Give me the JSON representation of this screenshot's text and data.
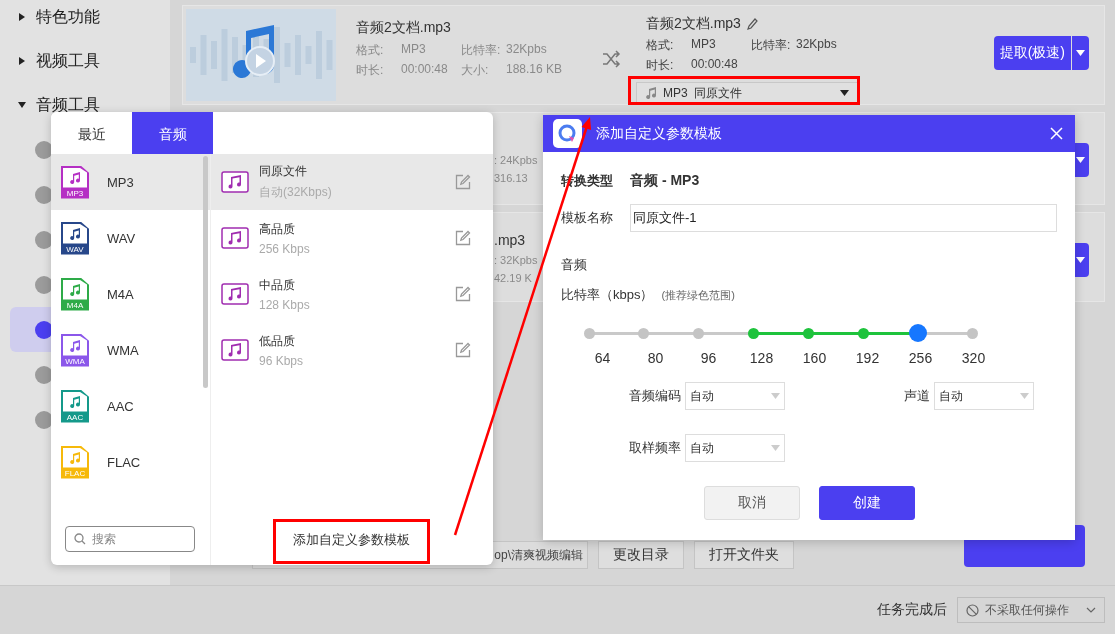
{
  "sidebar": {
    "items": [
      {
        "label": "特色功能",
        "expanded": false
      },
      {
        "label": "视频工具",
        "expanded": false
      },
      {
        "label": "音频工具",
        "expanded": true
      }
    ],
    "tools": [
      {
        "selected": false
      },
      {
        "selected": false
      },
      {
        "selected": false
      },
      {
        "selected": false
      },
      {
        "selected": true
      },
      {
        "selected": false
      },
      {
        "selected": false
      }
    ]
  },
  "files": [
    {
      "name": "音频2文档.mp3",
      "format_label": "格式:",
      "format": "MP3",
      "bitrate_label": "比特率:",
      "bitrate": "32Kpbs",
      "duration_label": "时长:",
      "duration": "00:00:48",
      "size_label": "大小:",
      "size": "188.16 KB",
      "output": {
        "name": "音频2文档.mp3",
        "format_label": "格式:",
        "format": "MP3",
        "bitrate_label": "比特率:",
        "bitrate": "32Kpbs",
        "duration_label": "时长:",
        "duration": "00:00:48",
        "preset_format": "MP3",
        "preset": "同原文件"
      },
      "action": "提取(极速)"
    }
  ],
  "covered_files": [
    {
      "lines": [
        ": 24Kpbs",
        "316.13"
      ]
    },
    {
      "name": ".mp3",
      "lines": [
        ": 32Kpbs",
        "42.19 K"
      ]
    }
  ],
  "output_bar": {
    "path": "op\\清爽视频编辑",
    "buttons": [
      "更改目录",
      "打开文件夹"
    ]
  },
  "footer": {
    "label": "任务完成后",
    "select": "不采取任何操作"
  },
  "format_popup": {
    "tabs": [
      {
        "label": "最近",
        "selected": false
      },
      {
        "label": "音频",
        "selected": true
      }
    ],
    "formats": [
      {
        "label": "MP3",
        "tag": "MP3",
        "color": "#b52fc4",
        "selected": true
      },
      {
        "label": "WAV",
        "tag": "WAV",
        "color": "#27478a",
        "selected": false
      },
      {
        "label": "M4A",
        "tag": "M4A",
        "color": "#2eab48",
        "selected": false
      },
      {
        "label": "WMA",
        "tag": "WMA",
        "color": "#8b57ea",
        "selected": false
      },
      {
        "label": "AAC",
        "tag": "AAC",
        "color": "#14998a",
        "selected": false
      },
      {
        "label": "FLAC",
        "tag": "FLAC",
        "color": "#f6b90a",
        "selected": false
      }
    ],
    "search_placeholder": "搜索",
    "presets": [
      {
        "name": "同原文件",
        "detail": "自动(32Kbps)",
        "selected": true
      },
      {
        "name": "高品质",
        "detail": "256 Kbps",
        "selected": false
      },
      {
        "name": "中品质",
        "detail": "128 Kbps",
        "selected": false
      },
      {
        "name": "低品质",
        "detail": "96 Kbps",
        "selected": false
      }
    ],
    "add_button": "添加自定义参数模板"
  },
  "dialog": {
    "title": "添加自定义参数模板",
    "type_label": "转换类型",
    "type_value": "音频 - MP3",
    "name_label": "模板名称",
    "name_value": "同原文件-1",
    "section": "音频",
    "bitrate_label": "比特率（kbps）",
    "bitrate_hint": "(推荐绿色范围)",
    "bitrates": [
      {
        "label": "64",
        "recommended": false,
        "selected": false
      },
      {
        "label": "80",
        "recommended": false,
        "selected": false
      },
      {
        "label": "96",
        "recommended": false,
        "selected": false
      },
      {
        "label": "128",
        "recommended": true,
        "selected": false
      },
      {
        "label": "160",
        "recommended": true,
        "selected": false
      },
      {
        "label": "192",
        "recommended": true,
        "selected": false
      },
      {
        "label": "256",
        "recommended": true,
        "selected": true
      },
      {
        "label": "320",
        "recommended": false,
        "selected": false
      }
    ],
    "selects": [
      {
        "label": "音频编码",
        "value": "自动"
      },
      {
        "label": "声道",
        "value": "自动"
      },
      {
        "label": "取样频率",
        "value": "自动"
      }
    ],
    "buttons": [
      {
        "label": "取消",
        "kind": "secondary"
      },
      {
        "label": "创建",
        "kind": "primary"
      }
    ]
  }
}
